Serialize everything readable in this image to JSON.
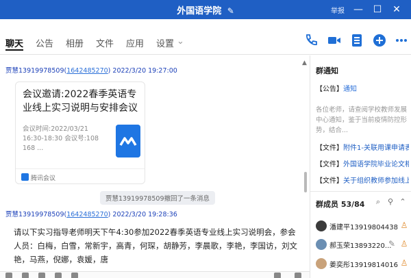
{
  "window": {
    "title": "外国语学院",
    "title_edit_icon": "edit-icon",
    "report_label": "举报",
    "controls": [
      "minimize-icon",
      "maximize-icon",
      "close-icon"
    ]
  },
  "tabs": [
    {
      "label": "聊天",
      "active": true
    },
    {
      "label": "公告"
    },
    {
      "label": "相册"
    },
    {
      "label": "文件"
    },
    {
      "label": "应用"
    },
    {
      "label": "设置"
    }
  ],
  "toolbar_icons": [
    "phone-icon",
    "video-icon",
    "classroom-icon",
    "add-icon",
    "more-icon"
  ],
  "messages": {
    "first": {
      "sender": "贾慧13919978509",
      "sender_id": "1642485270",
      "time": "2022/3/20 19:27:00"
    },
    "card": {
      "title": "会议邀请:2022春季英语专业线上实习说明与安排会议",
      "time_label": "会议时间:2022/03/21",
      "time_range": "16:30-18:30 会议号:108",
      "meeting_suffix": "168 ...",
      "app_name": "腾讯会议"
    },
    "recall_notice": "贾慧13919978509撤回了一条消息",
    "second": {
      "sender": "贾慧13919978509",
      "sender_id": "1642485270",
      "time": "2022/3/20 19:28:36",
      "body": "请以下实习指导老师明天下午4:30参加2022春季英语专业线上实习说明会，参会人员：白梅，白雪，常新宇，高青，何琛，胡静芳，李晨歌，李艳，李国访，刘文艳，马燕，倪娜，袁媛，唐"
    }
  },
  "right_panel": {
    "title": "群通知",
    "announcement_tag": "【公告】",
    "announcement_title": "通知",
    "announcement_text": "各位老师，请查阅学校教师发展中心通知，鉴于当前疫情防控形势，结合...",
    "files": [
      {
        "tag": "【文件】",
        "name": "附件1-关联用课申请表..."
      },
      {
        "tag": "【文件】",
        "name": "外国语学院毕业论文相..."
      },
      {
        "tag": "【文件】",
        "name": "关于组织教师参加线上..."
      }
    ],
    "members_label": "群成员 53/84",
    "members": [
      {
        "name": "潘建平13919804438",
        "avatar_color": "#3b3b3b"
      },
      {
        "name": "郝玉荣13893220...",
        "avatar_color": "#6b8fb3"
      },
      {
        "name": "姜奕彤13919814016",
        "avatar_color": "#c9a27a"
      }
    ]
  }
}
